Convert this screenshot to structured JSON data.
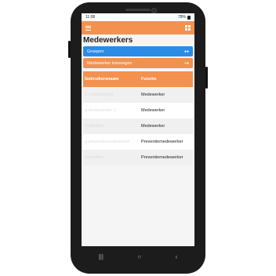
{
  "status": {
    "time": "11:08",
    "battery": "78%"
  },
  "appbar": {
    "menu_icon": "hamburger-icon",
    "grid_icon": "grid-icon"
  },
  "page": {
    "title": "Medewerkers"
  },
  "buttons": {
    "groups_label": "Groepen",
    "add_employee_label": "Medewerker toevoegen"
  },
  "table": {
    "headers": [
      "Gebruikersnaam",
      "Functie"
    ],
    "rows": [
      {
        "username": "h.t.mesekerk@…",
        "function": "Medewerker"
      },
      {
        "username": "a.medewerker-1",
        "function": "Medewerker"
      },
      {
        "username": "Gebruiker",
        "function": "Medewerker"
      },
      {
        "username": "p.preventiemedewerker",
        "function": "Preventiemedewerker"
      },
      {
        "username": "Gebruiker",
        "function": "Preventiemedewerker"
      }
    ]
  },
  "navbar": {
    "recent": "|||",
    "home": "○",
    "back": "‹"
  }
}
